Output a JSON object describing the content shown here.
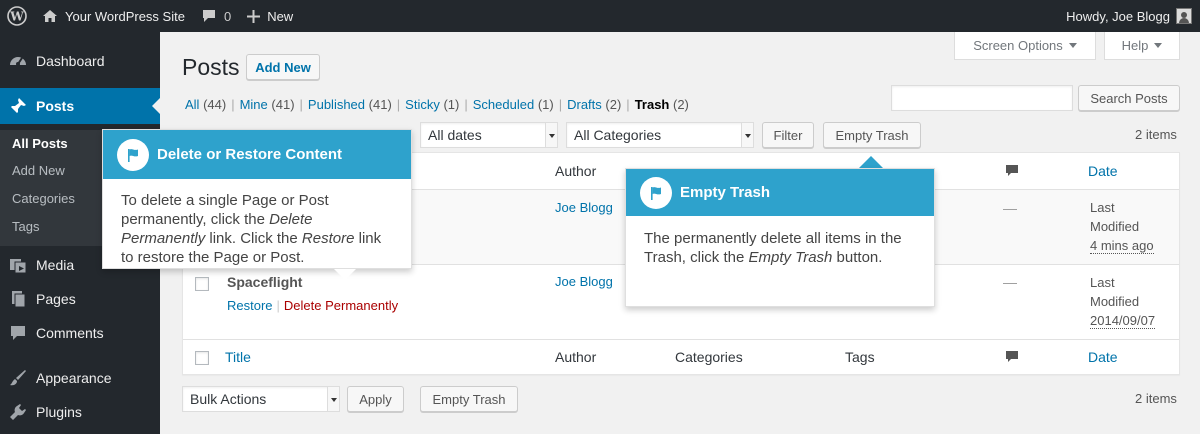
{
  "adminbar": {
    "site_name": "Your WordPress Site",
    "comments_count": "0",
    "new_label": "New",
    "howdy": "Howdy, Joe Blogg"
  },
  "sidebar": {
    "items": [
      {
        "label": "Dashboard",
        "icon": "dashboard-icon"
      },
      {
        "label": "Posts",
        "icon": "pin-icon"
      },
      {
        "label": "Media",
        "icon": "media-icon"
      },
      {
        "label": "Pages",
        "icon": "pages-icon"
      },
      {
        "label": "Comments",
        "icon": "comments-icon"
      },
      {
        "label": "Appearance",
        "icon": "brush-icon"
      },
      {
        "label": "Plugins",
        "icon": "plug-icon"
      }
    ],
    "submenu": [
      "All Posts",
      "Add New",
      "Categories",
      "Tags"
    ]
  },
  "header": {
    "title": "Posts",
    "add_new": "Add New",
    "screen_options": "Screen Options",
    "help": "Help"
  },
  "views": {
    "all": "All",
    "all_count": "(44)",
    "mine": "Mine",
    "mine_count": "(41)",
    "published": "Published",
    "published_count": "(41)",
    "sticky": "Sticky",
    "sticky_count": "(1)",
    "scheduled": "Scheduled",
    "scheduled_count": "(1)",
    "drafts": "Drafts",
    "drafts_count": "(2)",
    "trash": "Trash",
    "trash_count": "(2)"
  },
  "search": {
    "button": "Search Posts",
    "placeholder": ""
  },
  "top_nav": {
    "dates": "All dates",
    "categories": "All Categories",
    "filter": "Filter",
    "empty_trash": "Empty Trash",
    "items": "2 items"
  },
  "table": {
    "headers": {
      "title": "Title",
      "author": "Author",
      "categories": "Categories",
      "tags": "Tags",
      "date": "Date"
    },
    "rows": [
      {
        "author": "Joe Blogg",
        "comments": "—",
        "date_status": "Last Modified",
        "date": "4 mins ago"
      },
      {
        "title": "Spaceflight",
        "restore": "Restore",
        "delete": "Delete Permanently",
        "author": "Joe Blogg",
        "comments": "—",
        "date_status": "Last Modified",
        "date": "2014/09/07"
      }
    ]
  },
  "bottom_nav": {
    "bulk": "Bulk Actions",
    "apply": "Apply",
    "empty_trash": "Empty Trash",
    "items": "2 items"
  },
  "pointer_delete": {
    "title": "Delete or Restore Content",
    "t1": "To delete a single Page or Post permanently, click the ",
    "e1": "Delete Permanently",
    "t2": " link. Click the ",
    "e2": "Restore",
    "t3": " link to restore the Page or Post."
  },
  "pointer_empty": {
    "title": "Empty Trash",
    "t1": "The permanently delete all items in the Trash, click the ",
    "e1": "Empty Trash",
    "t2": " button."
  },
  "colors": {
    "admin_dark": "#23282d",
    "accent": "#0073aa",
    "pointer": "#2ea2cc",
    "delete": "#aa0000"
  }
}
